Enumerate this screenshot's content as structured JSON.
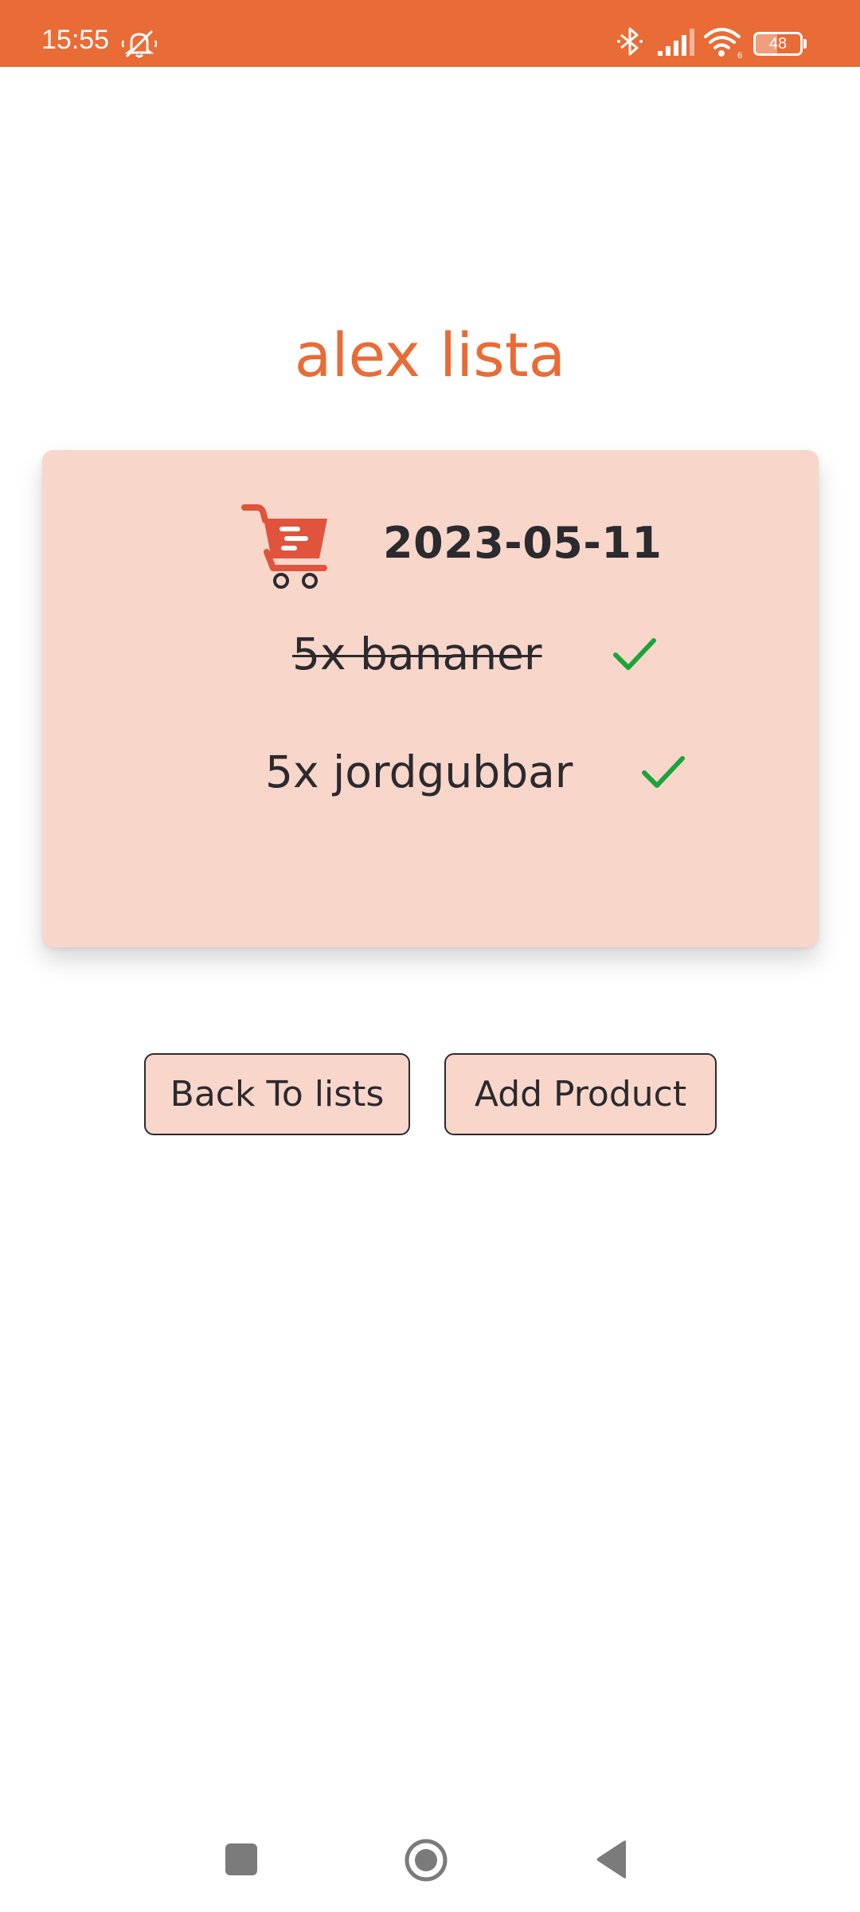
{
  "status_bar": {
    "time": "15:55",
    "battery": "48",
    "battery_level": 0.48,
    "icons": [
      "mute-icon",
      "bluetooth-icon",
      "signal-icon",
      "wifi-icon",
      "battery-icon"
    ],
    "background_color": "#e96b36"
  },
  "page": {
    "title": "alex lista",
    "title_color": "#e96b36"
  },
  "list": {
    "date": "2023-05-11",
    "icon": "shopping-cart-icon",
    "card_color": "#f9d6ca",
    "items": [
      {
        "label": "5x bananer",
        "done": true
      },
      {
        "label": "5x jordgubbar",
        "done": false
      }
    ],
    "check_color": "#1aa53c"
  },
  "buttons": {
    "back": "Back To lists",
    "add": "Add Product"
  },
  "nav_bar": {
    "icons": [
      "recents-icon",
      "home-icon",
      "back-icon"
    ]
  }
}
